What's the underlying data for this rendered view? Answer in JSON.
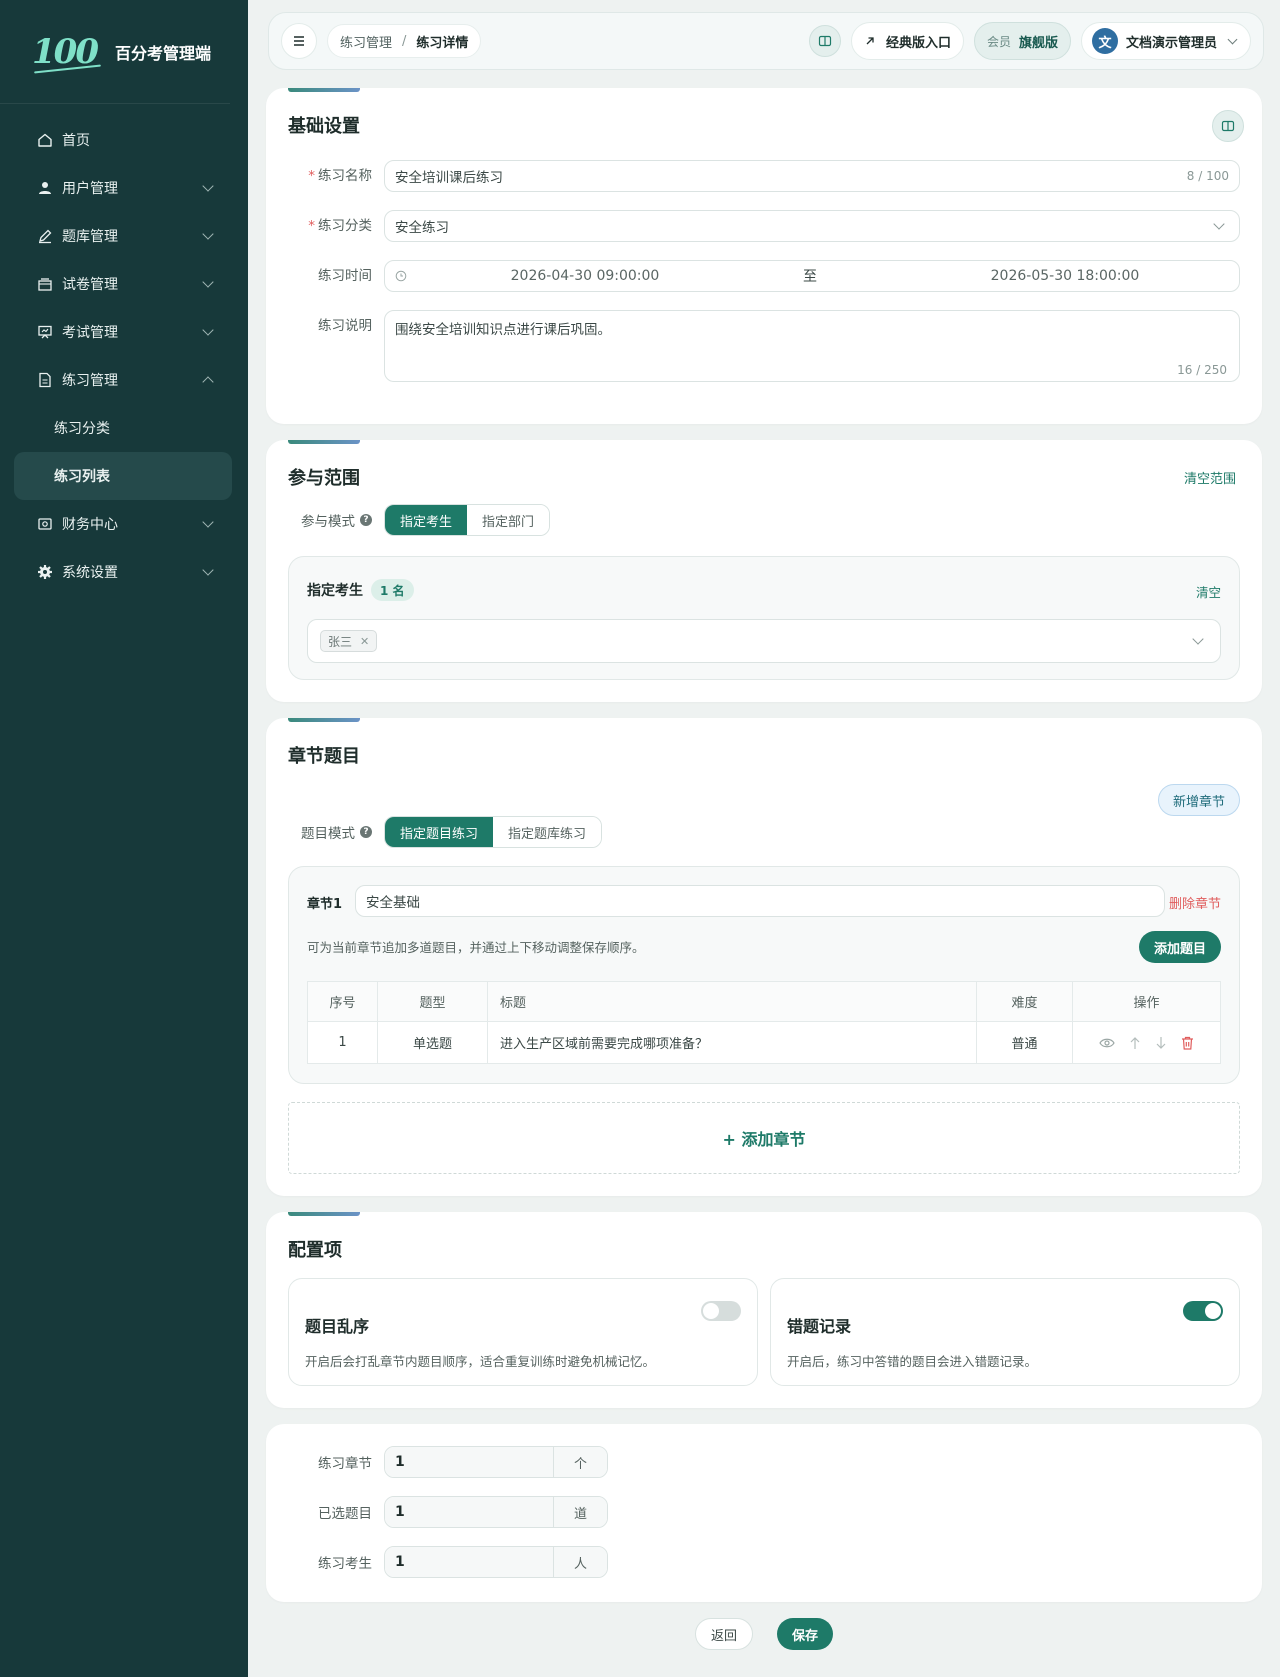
{
  "brand": {
    "logo_text": "100",
    "name": "百分考管理端"
  },
  "sidebar": {
    "items": [
      {
        "label": "首页",
        "icon": "home-icon"
      },
      {
        "label": "用户管理",
        "icon": "user-icon"
      },
      {
        "label": "题库管理",
        "icon": "edit-icon"
      },
      {
        "label": "试卷管理",
        "icon": "paper-icon"
      },
      {
        "label": "考试管理",
        "icon": "board-icon"
      },
      {
        "label": "练习管理",
        "icon": "document-icon"
      }
    ],
    "sub_items": [
      {
        "label": "练习分类"
      },
      {
        "label": "练习列表"
      }
    ],
    "bottom_items": [
      {
        "label": "财务中心",
        "icon": "finance-icon"
      },
      {
        "label": "系统设置",
        "icon": "gear-icon"
      }
    ]
  },
  "topbar": {
    "breadcrumb": {
      "parent": "练习管理",
      "separator": "/",
      "current": "练习详情"
    },
    "classic_entry": "经典版入口",
    "member_label": "会员",
    "member_level": "旗舰版",
    "user_avatar": "文",
    "user_name": "文档演示管理员"
  },
  "basic": {
    "title": "基础设置",
    "name_label": "练习名称",
    "name_value": "安全培训课后练习",
    "name_count": "8 / 100",
    "category_label": "练习分类",
    "category_value": "安全练习",
    "time_label": "练习时间",
    "time_start": "2026-04-30 09:00:00",
    "time_sep": "至",
    "time_end": "2026-05-30 18:00:00",
    "desc_label": "练习说明",
    "desc_value": "围绕安全培训知识点进行课后巩固。",
    "desc_count": "16 / 250"
  },
  "scope": {
    "title": "参与范围",
    "clear_label": "清空范围",
    "mode_label": "参与模式",
    "mode_options": [
      "指定考生",
      "指定部门"
    ],
    "box_title": "指定考生",
    "box_count": "1 名",
    "box_clear": "清空",
    "tags": [
      "张三"
    ]
  },
  "chapters": {
    "title": "章节题目",
    "add_chapter_top": "新增章节",
    "mode_label": "题目模式",
    "mode_options": [
      "指定题目练习",
      "指定题库练习"
    ],
    "chapter_label": "章节1",
    "chapter_name": "安全基础",
    "delete_chapter": "删除章节",
    "hint": "可为当前章节追加多道题目，并通过上下移动调整保存顺序。",
    "add_question": "添加题目",
    "table": {
      "headers": [
        "序号",
        "题型",
        "标题",
        "难度",
        "操作"
      ],
      "rows": [
        {
          "index": "1",
          "type": "单选题",
          "title": "进入生产区域前需要完成哪项准备？",
          "difficulty": "普通"
        }
      ]
    },
    "add_chapter_bottom": "+ 添加章节"
  },
  "config": {
    "title": "配置项",
    "shuffle_title": "题目乱序",
    "shuffle_desc": "开启后会打乱章节内题目顺序，适合重复训练时避免机械记忆。",
    "shuffle_on": false,
    "wrong_title": "错题记录",
    "wrong_desc": "开启后，练习中答错的题目会进入错题记录。",
    "wrong_on": true
  },
  "summary": {
    "rows": [
      {
        "label": "练习章节",
        "value": "1",
        "unit": "个"
      },
      {
        "label": "已选题目",
        "value": "1",
        "unit": "道"
      },
      {
        "label": "练习考生",
        "value": "1",
        "unit": "人"
      }
    ]
  },
  "footer": {
    "back_label": "返回",
    "save_label": "保存"
  },
  "colors": {
    "primary": "#1e7a68",
    "sidebar_bg": "#17393a",
    "danger": "#e05d5d"
  }
}
